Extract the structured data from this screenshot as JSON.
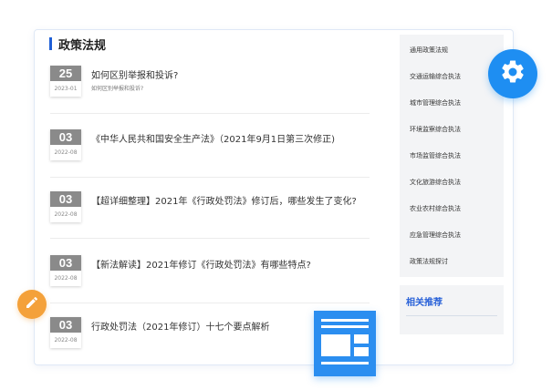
{
  "header": {
    "title": "政策法规"
  },
  "news": [
    {
      "day": "25",
      "month": "2023-01",
      "title": "如何区别举报和投诉?",
      "subtitle": "如何区别举报和投诉?"
    },
    {
      "day": "03",
      "month": "2022-08",
      "title": "《中华人民共和国安全生产法》（2021年9月1日第三次修正)"
    },
    {
      "day": "03",
      "month": "2022-08",
      "title": "【超详细整理】2021年《行政处罚法》修订后，哪些发生了变化?"
    },
    {
      "day": "03",
      "month": "2022-08",
      "title": "【新法解读】2021年修订《行政处罚法》有哪些特点?"
    },
    {
      "day": "03",
      "month": "2022-08",
      "title": "行政处罚法（2021年修订）十七个要点解析"
    }
  ],
  "sidebar": {
    "items": [
      "通用政策法规",
      "交通运输综合执法",
      "城市管理综合执法",
      "环境监察综合执法",
      "市场监管综合执法",
      "文化旅游综合执法",
      "农业农村综合执法",
      "应急管理综合执法",
      "政策法规探讨"
    ]
  },
  "recommend": {
    "title": "相关推荐"
  },
  "icons": {
    "gear": "gear-icon",
    "pencil": "pencil-icon",
    "document": "document-icon"
  },
  "colors": {
    "accent": "#1f5fd6",
    "gear_badge": "#1e8ef2",
    "pencil_badge": "#f4a13a",
    "doc_card": "#2b8ef0",
    "date_header": "#8a8a8a"
  }
}
